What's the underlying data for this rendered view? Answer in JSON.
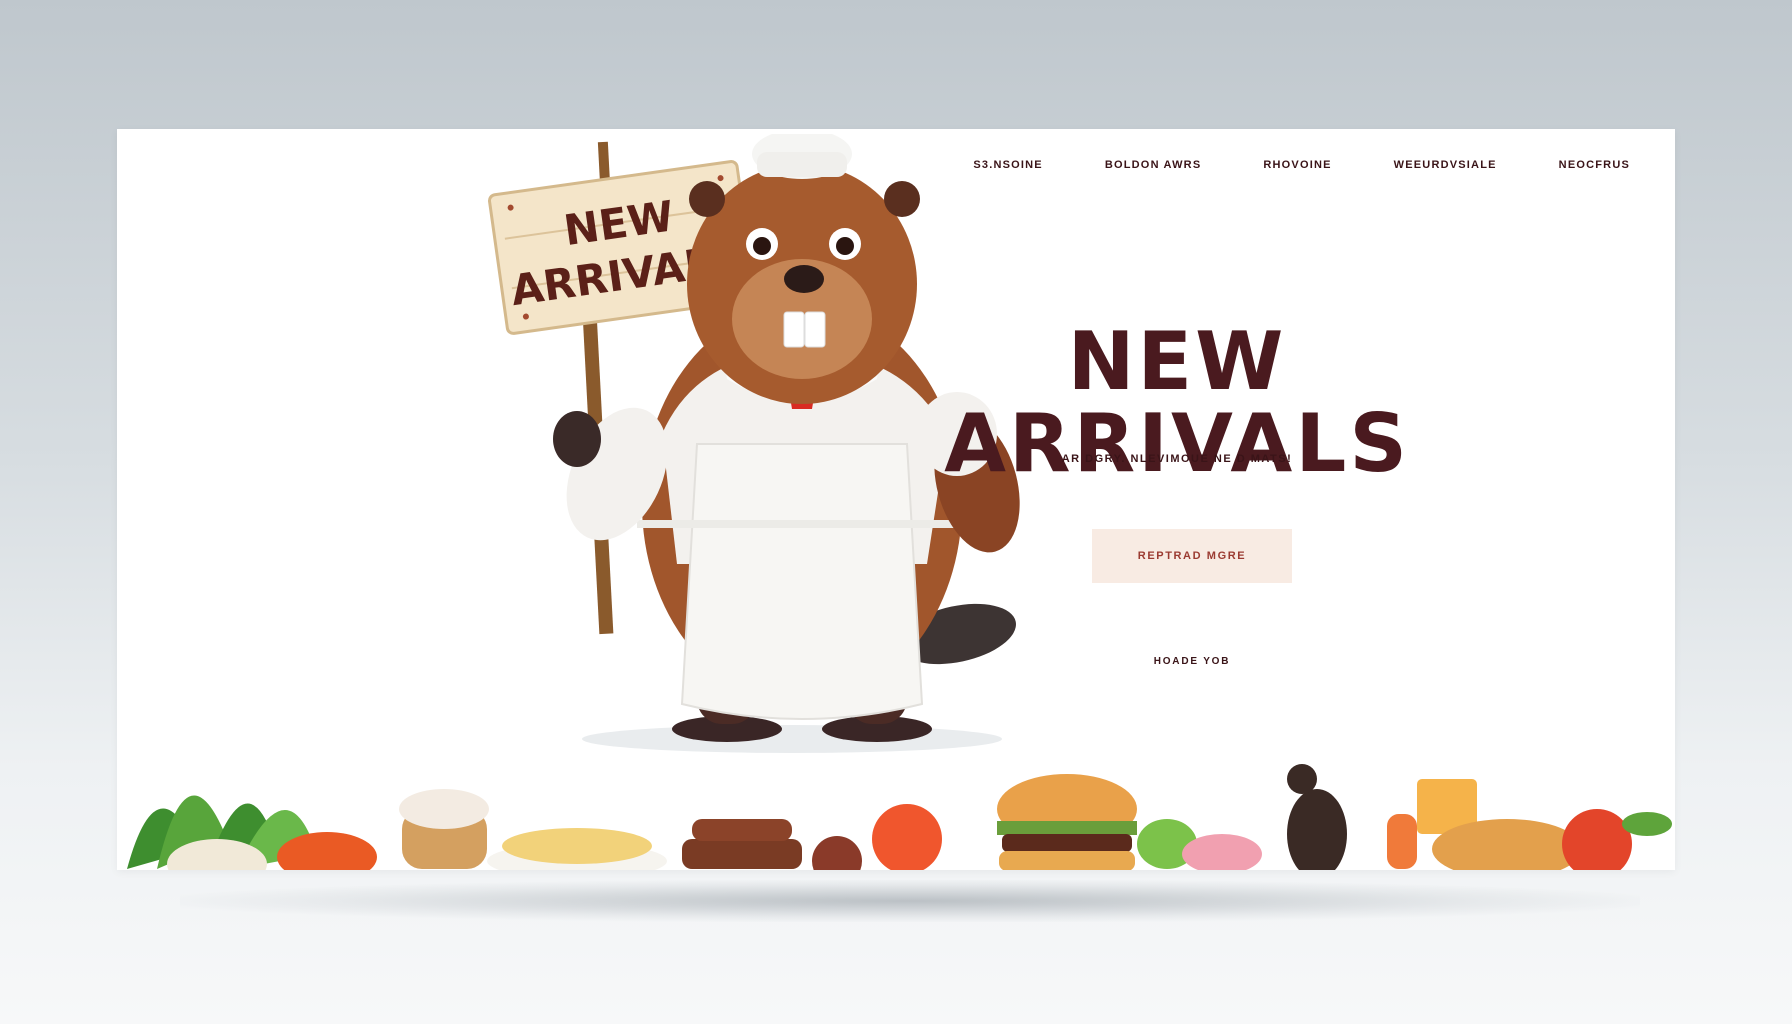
{
  "nav": {
    "items": [
      "S3.NSOINE",
      "BOLDON AWRS",
      "RHOVOINE",
      "WEEURDVSIALE",
      "NEOCFRUS"
    ]
  },
  "sign": {
    "line1": "NEW",
    "line2": "ARRIVALS"
  },
  "hero": {
    "title_line1": "NEW",
    "title_line2": "ARRIVALS",
    "subtitle": "AR DGRY. NLEVIMOUE NE D MATS!",
    "cta_label": "REPTRAD MGRE",
    "secondary_label": "HOADE YOB"
  },
  "colors": {
    "brand": "#4a1a1f",
    "cta_bg": "#f8ebe3",
    "cta_text": "#9b3b32"
  },
  "icons": [
    "beaver-chef-mascot",
    "wooden-sign",
    "food-strip"
  ]
}
